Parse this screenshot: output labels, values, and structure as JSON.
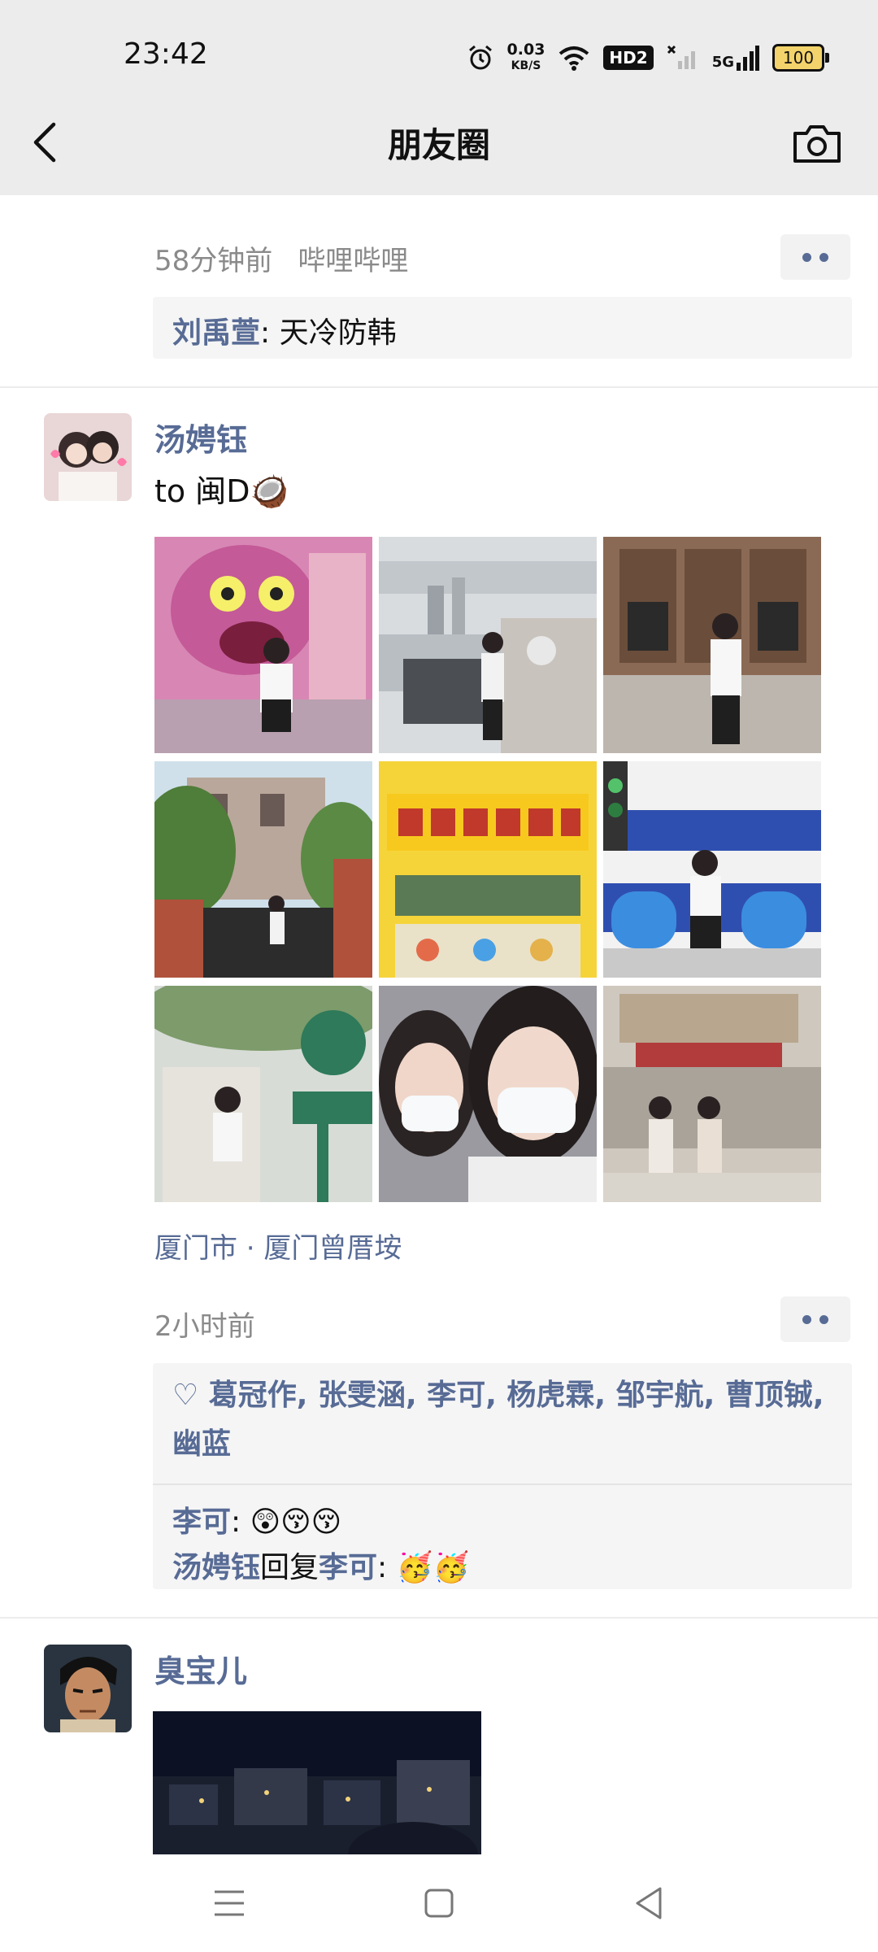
{
  "status_bar": {
    "time": "23:42",
    "net_speed": "0.03",
    "net_unit": "KB/S",
    "hd_label": "HD2",
    "signal_label": "5G",
    "battery": "100"
  },
  "header": {
    "title": "朋友圈"
  },
  "post1": {
    "time": "58分钟前",
    "app": "哔哩哔哩",
    "comment_name": "刘禹萱",
    "comment_sep": ": ",
    "comment_text": "天冷防韩"
  },
  "post2": {
    "author": "汤娉钰",
    "text": "to 闽D🥥",
    "location": "厦门市 · 厦门曾厝垵",
    "time": "2小时前",
    "likes": "♡ 葛冠作, 张雯涵, 李可, 杨虎霖, 邹宇航, 曹顶铖, 幽蓝",
    "comment1_name": "李可",
    "comment1_sep": ": ",
    "comment1_text": "😲😚😚",
    "comment2_name": "汤娉钰",
    "comment2_mid": "回复",
    "comment2_name2": "李可",
    "comment2_sep": ": ",
    "comment2_text": "🥳🥳",
    "photos": [
      "graffiti-photo",
      "riverside-photo",
      "cafe-photo",
      "villa-photo",
      "shop-sign-photo",
      "blue-bench-photo",
      "sign-post-photo",
      "selfie-photo",
      "street-photo"
    ]
  },
  "post3": {
    "author": "臭宝儿"
  },
  "colors": {
    "link": "#576b95",
    "meta": "#8a8a8a",
    "header_bg": "#ececec",
    "comment_bg": "#f5f5f5"
  }
}
